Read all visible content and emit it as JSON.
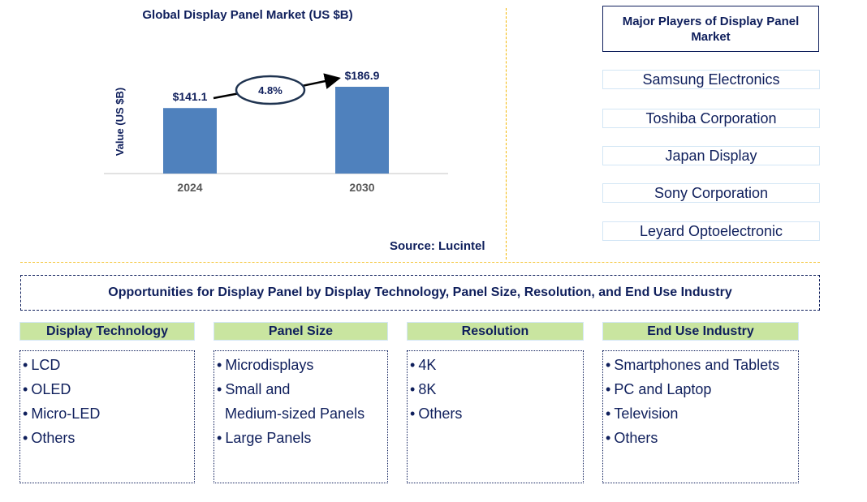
{
  "chart_data": {
    "type": "bar",
    "title": "Global Display Panel Market (US $B)",
    "xlabel": "",
    "ylabel": "Value (US $B)",
    "categories": [
      "2024",
      "2030"
    ],
    "values": [
      141.1,
      186.9
    ],
    "data_labels": [
      "$141.1",
      "$186.9"
    ],
    "ylim": [
      0,
      200
    ],
    "grid": false,
    "annotation": {
      "type": "CAGR arrow",
      "label": "4.8%"
    },
    "bar_color": "#4f81bd"
  },
  "source": "Source: Lucintel",
  "players": {
    "title": "Major Players of Display Panel Market",
    "items": [
      "Samsung Electronics",
      "Toshiba Corporation",
      "Japan Display",
      "Sony Corporation",
      "Leyard Optoelectronic"
    ]
  },
  "opportunities": {
    "title": "Opportunities for Display Panel by Display Technology, Panel Size, Resolution, and End Use Industry",
    "categories": [
      {
        "label": "Display Technology",
        "items": [
          "LCD",
          "OLED",
          "Micro-LED",
          "Others"
        ]
      },
      {
        "label": "Panel Size",
        "items": [
          "Microdisplays",
          "Small and",
          "Medium-sized Panels",
          "Large Panels"
        ]
      },
      {
        "label": "Resolution",
        "items": [
          "4K",
          "8K",
          "Others"
        ]
      },
      {
        "label": "End Use Industry",
        "items": [
          "Smartphones and Tablets",
          "PC and Laptop",
          "Television",
          "Others"
        ]
      }
    ]
  },
  "colors": {
    "navy": "#0f1f5c",
    "bar": "#4f81bd",
    "header_green": "#c9e5a0",
    "divider_gold": "#f2b705"
  }
}
